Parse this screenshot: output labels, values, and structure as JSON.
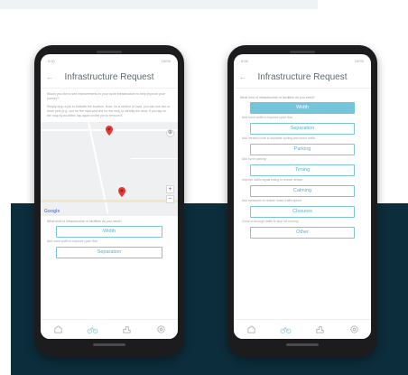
{
  "colors": {
    "accent": "#74c4da",
    "background_dark": "#0c2d3b"
  },
  "left_phone": {
    "status": {
      "time": "9:00",
      "battery": "100%"
    },
    "title": "Infrastructure Request",
    "intro": "Would you like to see improvements to your cycle infrastructure to help improve your journey?",
    "instructions": "Simply drop a pin to indicate the location. Note: for a section of road, you can use two or more pins (e.g. one for the start and one for the end) to identify the area. If you tap on the map by accident, tap again on the pin to remove it.",
    "question": "What kind of infrastructure or facilities do you need?",
    "map": {
      "attribution": "Google",
      "zoom_in": "+",
      "zoom_out": "−"
    },
    "options": [
      {
        "label": "Width",
        "desc": "Add more width to improve cycle flow"
      },
      {
        "label": "Separation",
        "desc": ""
      }
    ],
    "tabs": [
      "home-icon",
      "bike-icon",
      "map-icon",
      "settings-icon"
    ]
  },
  "right_phone": {
    "status": {
      "time": "9:00",
      "battery": "100%"
    },
    "title": "Infrastructure Request",
    "question": "What kind of infrastructure or facilities do you need?",
    "options": [
      {
        "label": "Width",
        "desc": "Add more width to improve cycle flow",
        "selected": true
      },
      {
        "label": "Separation",
        "desc": "Add infrastructure to separate cycling and motor traffic"
      },
      {
        "label": "Parking",
        "desc": "Add cycle parking"
      },
      {
        "label": "Timing",
        "desc": "Improve traffic signal timing to reduce delays"
      },
      {
        "label": "Calming",
        "desc": "Add measures to reduce motor traffic speed"
      },
      {
        "label": "Closures",
        "desc": "Close to through traffic to stop rat-running"
      },
      {
        "label": "Other",
        "desc": ""
      }
    ],
    "tabs": [
      "home-icon",
      "bike-icon",
      "map-icon",
      "settings-icon"
    ]
  }
}
